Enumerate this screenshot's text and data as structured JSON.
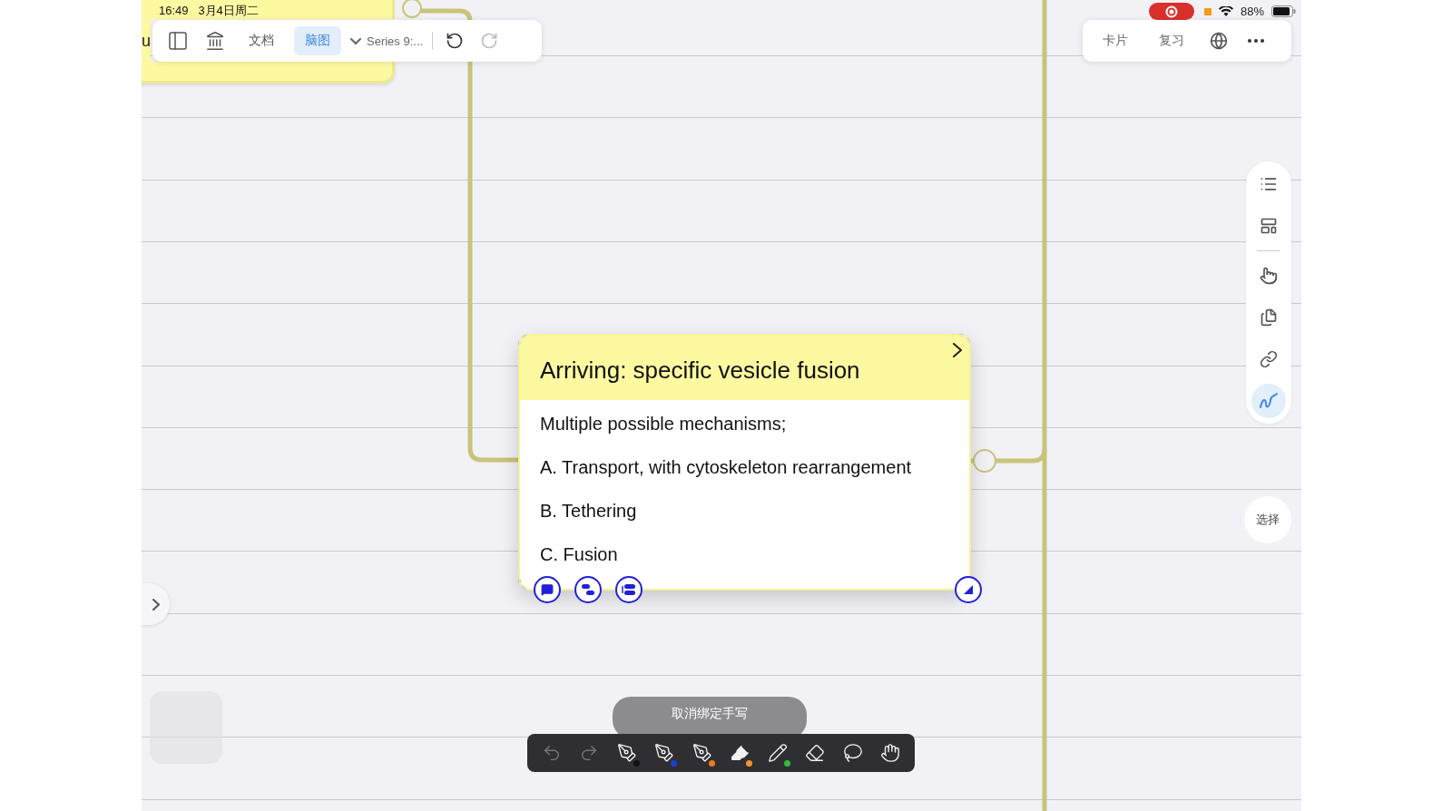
{
  "status_bar": {
    "time": "16:49",
    "date": "3月4日周二",
    "battery": "88%"
  },
  "partial_text": "u",
  "top_toolbar": {
    "tabs": [
      {
        "label": "文档",
        "selected": false
      },
      {
        "label": "脑图",
        "selected": true
      }
    ],
    "breadcrumb": "Series 9:..."
  },
  "right_toolbar": {
    "buttons": [
      "卡片",
      "复习"
    ]
  },
  "side_tools": [
    {
      "kind": "outline",
      "selected": false
    },
    {
      "kind": "layout",
      "selected": false
    },
    {
      "kind": "pointer",
      "selected": false
    },
    {
      "kind": "copy",
      "selected": false
    },
    {
      "kind": "link",
      "selected": false
    },
    {
      "kind": "handwriting",
      "selected": true
    }
  ],
  "select_button": "选择",
  "card": {
    "title": "Arriving: specific vesicle fusion",
    "lines": [
      "Multiple possible mechanisms;",
      "A. Transport, with cytoskeleton rearrangement",
      "B. Tethering",
      "C. Fusion"
    ]
  },
  "toast": "取消绑定手写",
  "pen_toolbar": [
    {
      "kind": "undo",
      "selected": false
    },
    {
      "kind": "redo",
      "selected": false
    },
    {
      "kind": "pen",
      "color": "#111111",
      "selected": false
    },
    {
      "kind": "pen",
      "color": "#1a3fd8",
      "selected": false
    },
    {
      "kind": "pen",
      "color": "#f07a1a",
      "selected": false
    },
    {
      "kind": "highlighter",
      "color": "#f0962a",
      "selected": true
    },
    {
      "kind": "pencil",
      "color": "#2fbf3a",
      "selected": false
    },
    {
      "kind": "eraser",
      "selected": false
    },
    {
      "kind": "lasso",
      "selected": false
    },
    {
      "kind": "hand",
      "selected": false
    }
  ]
}
